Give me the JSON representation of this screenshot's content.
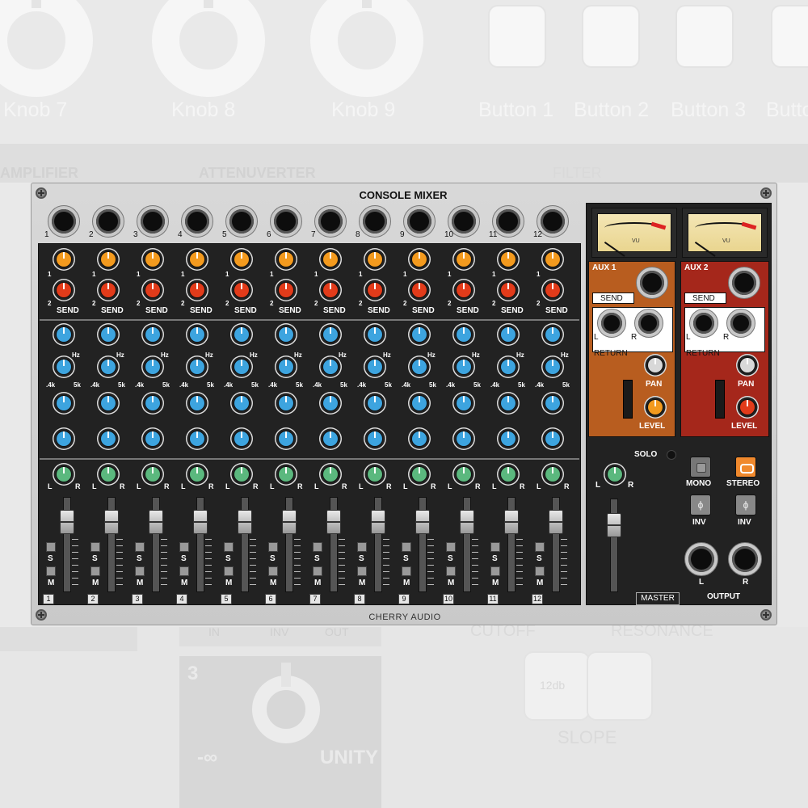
{
  "background": {
    "knob_labels": [
      "Knob 7",
      "Knob 8",
      "Knob 9"
    ],
    "button_labels": [
      "Button 1",
      "Button 2",
      "Button 3",
      "Butto"
    ],
    "module_names": [
      "AMPLIFIER",
      "ATTENUVERTER",
      "FILTER"
    ],
    "bottom_labels": [
      "CUTOFF",
      "RESONANCE",
      "SLOPE",
      "12db",
      "-∞",
      "UNITY",
      "3"
    ],
    "side_labels": [
      "IN",
      "INV",
      "OUT"
    ]
  },
  "module": {
    "title": "CONSOLE MIXER",
    "brand": "CHERRY AUDIO",
    "channels": [
      "1",
      "2",
      "3",
      "4",
      "5",
      "6",
      "7",
      "8",
      "9",
      "10",
      "11",
      "12"
    ],
    "send_label": "SEND",
    "send_top_num": "1",
    "send_bottom_num": "2",
    "eq": {
      "hz": "Hz",
      "low": ".4k",
      "high": "5k"
    },
    "pan": {
      "left": "L",
      "right": "R"
    },
    "solo_btn": "S",
    "mute_btn": "M",
    "aux": [
      {
        "name": "AUX 1",
        "send": "SEND",
        "return": "RETURN",
        "left": "L",
        "right": "R",
        "pan": "PAN",
        "level": "LEVEL",
        "color": "#b85d1f",
        "level_knob": "orange"
      },
      {
        "name": "AUX 2",
        "send": "SEND",
        "return": "RETURN",
        "left": "L",
        "right": "R",
        "pan": "PAN",
        "level": "LEVEL",
        "color": "#a5271b",
        "level_knob": "red"
      }
    ],
    "vu_label": "VU",
    "solo": "SOLO",
    "mono": "MONO",
    "stereo": "STEREO",
    "inv": "INV",
    "inv_symbol": "ϕ",
    "master": "MASTER",
    "output": "OUTPUT",
    "out_left": "L",
    "out_right": "R",
    "master_pan_left": "L",
    "master_pan_right": "R"
  },
  "colors": {
    "send1": "#f39a1e",
    "send2": "#e23b1a",
    "eq": "#3da4df",
    "pan": "#5bb87e",
    "aux1": "#b85d1f",
    "aux2": "#a5271b"
  }
}
